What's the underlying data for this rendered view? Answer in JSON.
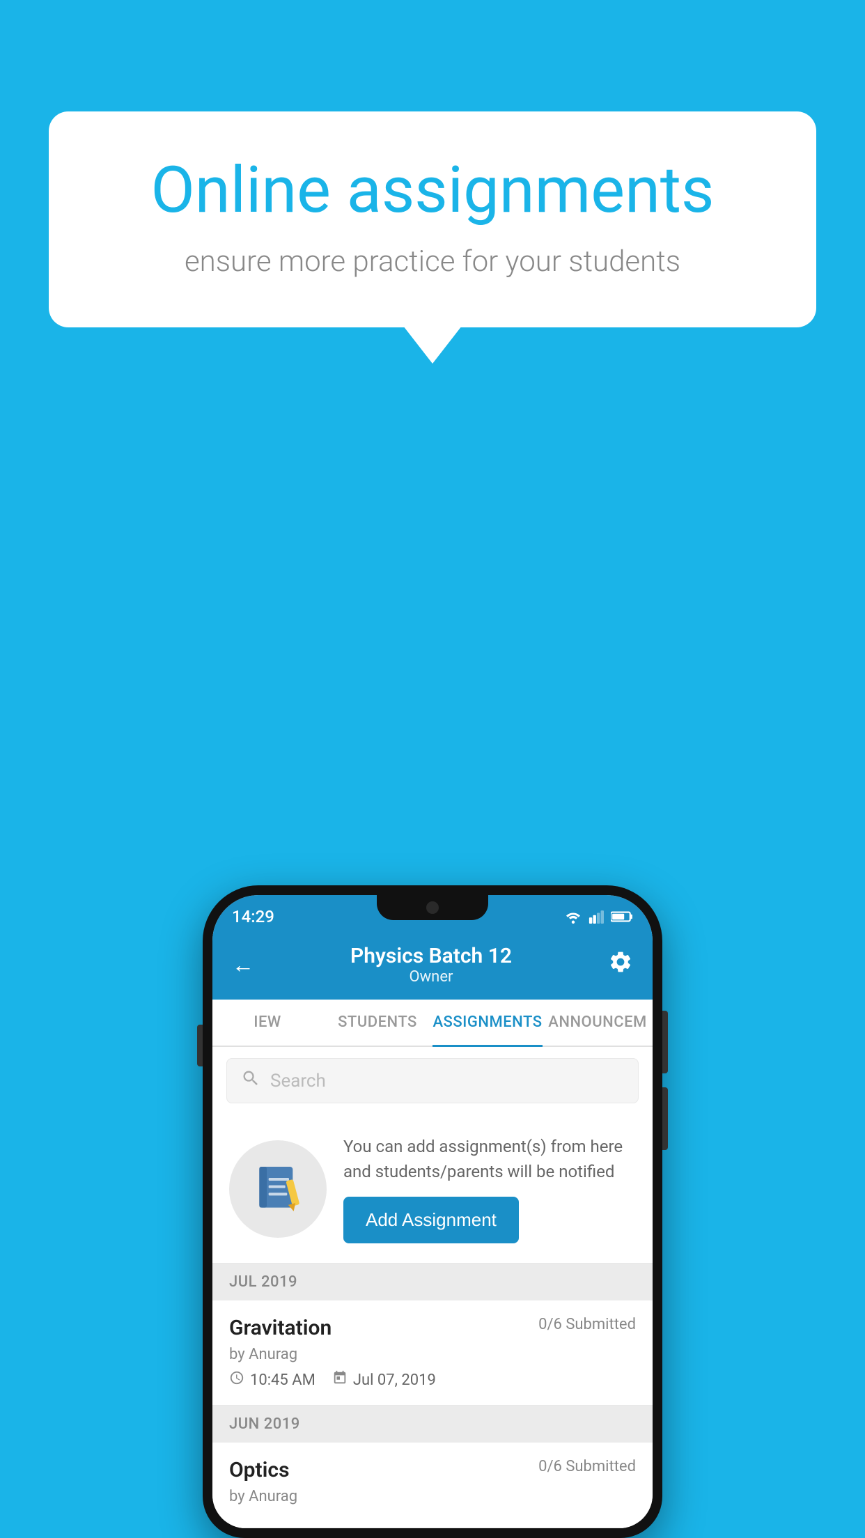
{
  "background": {
    "color": "#1ab4e8"
  },
  "speech_bubble": {
    "title": "Online assignments",
    "subtitle": "ensure more practice for your students"
  },
  "status_bar": {
    "time": "14:29"
  },
  "header": {
    "title": "Physics Batch 12",
    "subtitle": "Owner"
  },
  "tabs": [
    {
      "label": "IEW",
      "active": false
    },
    {
      "label": "STUDENTS",
      "active": false
    },
    {
      "label": "ASSIGNMENTS",
      "active": true
    },
    {
      "label": "ANNOUNCEM",
      "active": false
    }
  ],
  "search": {
    "placeholder": "Search"
  },
  "promo": {
    "text": "You can add assignment(s) from here and students/parents will be notified",
    "button_label": "Add Assignment"
  },
  "sections": [
    {
      "month_label": "JUL 2019",
      "assignments": [
        {
          "name": "Gravitation",
          "status": "0/6 Submitted",
          "author": "by Anurag",
          "time": "10:45 AM",
          "date": "Jul 07, 2019"
        }
      ]
    },
    {
      "month_label": "JUN 2019",
      "assignments": [
        {
          "name": "Optics",
          "status": "0/6 Submitted",
          "author": "by Anurag",
          "time": "",
          "date": ""
        }
      ]
    }
  ]
}
